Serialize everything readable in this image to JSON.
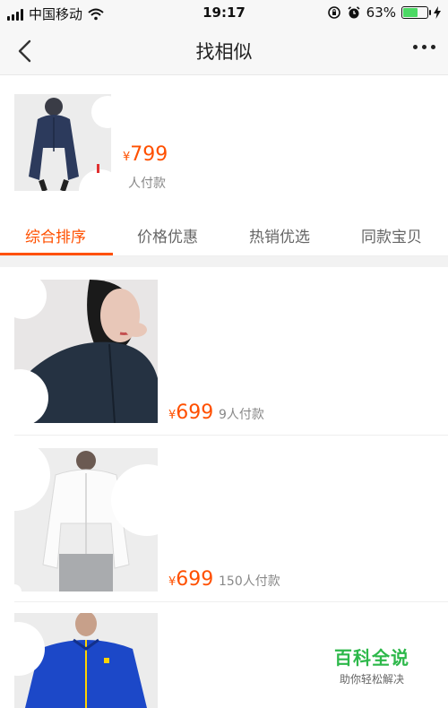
{
  "status_bar": {
    "carrier": "中国移动",
    "time": "19:17",
    "battery_percent": "63%",
    "battery_level": 0.63,
    "icons": [
      "signal-icon",
      "wifi-icon",
      "orientation-lock-icon",
      "alarm-icon",
      "battery-icon",
      "charging-icon"
    ]
  },
  "nav": {
    "title": "找相似",
    "back_icon": "back-chevron-icon",
    "more_icon": "more-dots-icon"
  },
  "source_product": {
    "currency": "¥",
    "price": "799",
    "sales": "人付款"
  },
  "tabs": [
    {
      "label": "综合排序",
      "active": true
    },
    {
      "label": "价格优惠",
      "active": false
    },
    {
      "label": "热销优选",
      "active": false
    },
    {
      "label": "同款宝贝",
      "active": false
    }
  ],
  "items": [
    {
      "currency": "¥",
      "price": "699",
      "sales": "9人付款",
      "image": "dark-zip-jacket-woman"
    },
    {
      "currency": "¥",
      "price": "699",
      "sales": "150人付款",
      "image": "white-hooded-jacket-man"
    },
    {
      "currency": "¥",
      "price": "",
      "sales": "",
      "image": "blue-track-jacket-man"
    }
  ],
  "watermark": {
    "title": "百科全说",
    "subtitle": "助你轻松解决"
  },
  "colors": {
    "accent": "#ff5000",
    "watermark_green": "#2db84a",
    "battery_green": "#4cd964"
  }
}
